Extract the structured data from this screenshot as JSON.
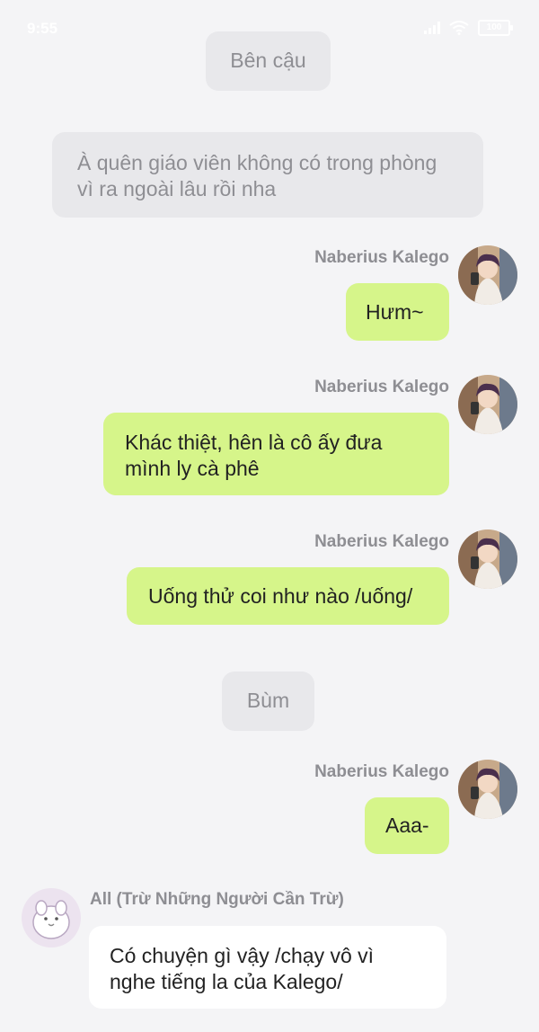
{
  "status_bar": {
    "time": "9:55",
    "battery": "100"
  },
  "messages": [
    {
      "type": "system",
      "text": "Bên cậu"
    },
    {
      "type": "system",
      "line1": "À quên giáo viên không có trong phòng",
      "line2": "vì ra ngoài lâu rồi nha"
    },
    {
      "type": "outgoing",
      "sender": "Naberius Kalego",
      "line1": "Hưm~"
    },
    {
      "type": "outgoing",
      "sender": "Naberius Kalego",
      "line1": "Khác thiệt, hên là cô ấy đưa",
      "line2": "mình ly cà phê"
    },
    {
      "type": "outgoing",
      "sender": "Naberius Kalego",
      "line1": "Uống thử coi như nào /uống/"
    },
    {
      "type": "system",
      "text": "Bùm"
    },
    {
      "type": "outgoing",
      "sender": "Naberius Kalego",
      "line1": "Aaa-"
    },
    {
      "type": "incoming",
      "sender": "All (Trừ Những Người Cần Trừ)",
      "line1": "Có chuyện gì vậy /chạy vô vì",
      "line2": "nghe tiếng la của Kalego/"
    }
  ],
  "colors": {
    "background": "#f4f4f6",
    "outgoing_bubble": "#d6f58a",
    "incoming_bubble": "#ffffff",
    "system_bubble": "#e8e8eb"
  }
}
